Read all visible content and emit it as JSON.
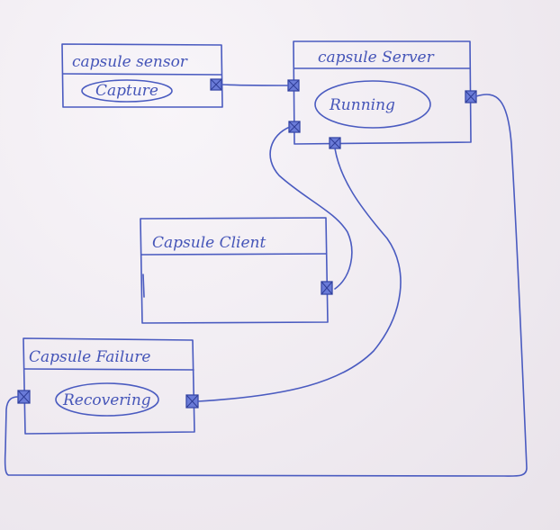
{
  "capsules": [
    {
      "id": "sensor",
      "title": "capsule sensor",
      "state": "Capture"
    },
    {
      "id": "server",
      "title": "capsule Server",
      "state": "Running"
    },
    {
      "id": "client",
      "title": "Capsule Client",
      "state": ""
    },
    {
      "id": "failure",
      "title": "Capsule Failure",
      "state": "Recovering"
    }
  ],
  "connections": [
    {
      "from": "sensor.out",
      "to": "server.in_top"
    },
    {
      "from": "server.in_left",
      "to": "client.port"
    },
    {
      "from": "server.bottom",
      "to": "failure.right"
    },
    {
      "from": "server.right",
      "to": "failure.left"
    }
  ],
  "colors": {
    "ink": "#4a5bc0",
    "paper": "#f3eff4"
  }
}
